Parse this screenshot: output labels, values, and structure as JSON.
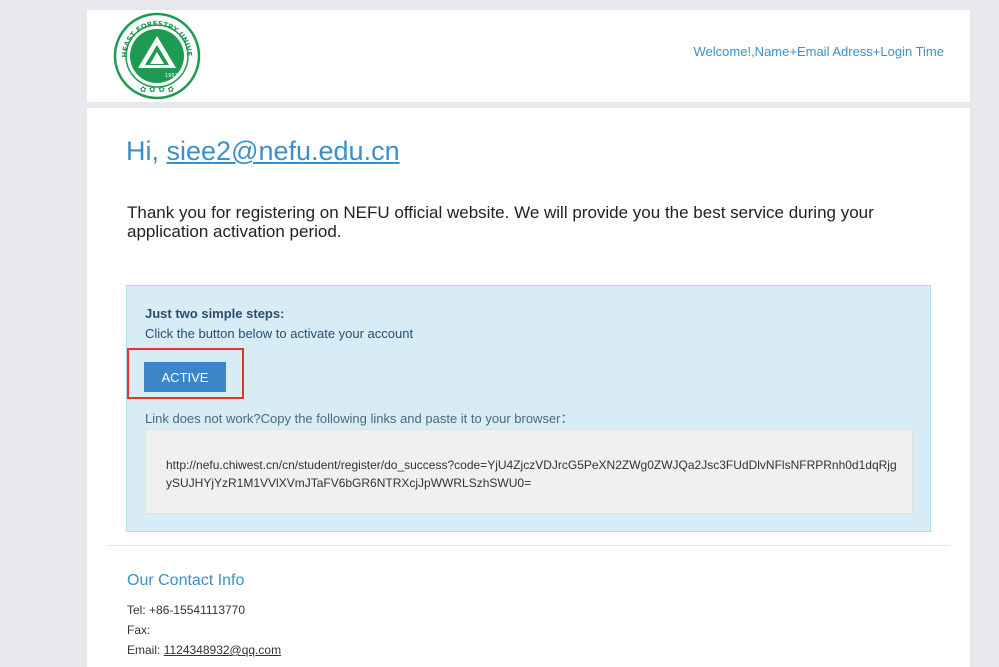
{
  "header": {
    "logo_text": "NORTHEAST FORESTRY UNIVERSITY",
    "logo_year": "1952",
    "welcome": "Welcome!,Name+Email Adress+Login Time"
  },
  "greeting": {
    "prefix": "Hi,",
    "email": "siee2@nefu.edu.cn"
  },
  "intro": "Thank you for registering on NEFU official website. We will provide you the best service during your application activation period.",
  "steps": {
    "title": "Just two simple steps:",
    "subtitle": "Click the button below to activate your account",
    "button_label": "ACTIVE",
    "link_note": "Link does not work?Copy the following links and paste it to your browser：",
    "url": "http://nefu.chiwest.cn/cn/student/register/do_success?code=YjU4ZjczVDJrcG5PeXN2ZWg0ZWJQa2Jsc3FUdDlvNFlsNFRPRnh0d1dqRjgySUJHYjYzR1M1VVlXVmJTaFV6bGR6NTRXcjJpWWRLSzhSWU0="
  },
  "contact": {
    "title": "Our Contact Info",
    "tel_label": "Tel:",
    "tel": "+86-15541113770",
    "fax_label": "Fax:",
    "email_label": "Email:",
    "email": "1124348932@qq.com"
  },
  "colors": {
    "accent": "#3c8fc9",
    "button": "#3a86c8",
    "box_bg": "#d7ecf4",
    "highlight": "#e5332e",
    "logo_green": "#1f9a52"
  }
}
